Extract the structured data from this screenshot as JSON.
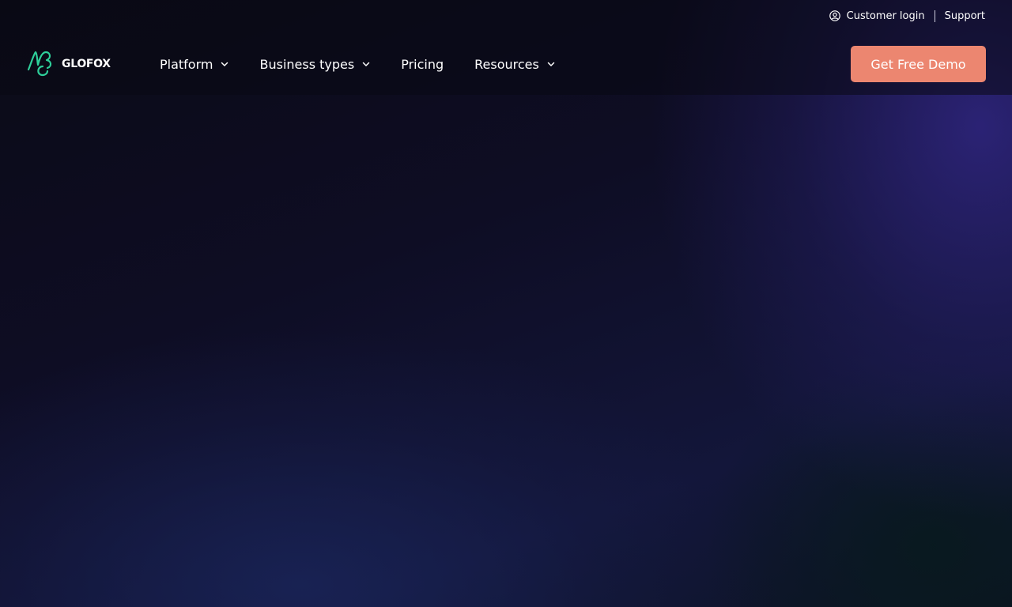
{
  "brand": {
    "name": "GLOFOX",
    "mark_color": "#2ecf9a"
  },
  "utility": {
    "customer_login": "Customer login",
    "support": "Support"
  },
  "nav": {
    "items": [
      {
        "label": "Platform",
        "has_dropdown": true
      },
      {
        "label": "Business types",
        "has_dropdown": true
      },
      {
        "label": "Pricing",
        "has_dropdown": false
      },
      {
        "label": "Resources",
        "has_dropdown": true
      }
    ]
  },
  "cta": {
    "label": "Get Free Demo",
    "color": "#ec8670"
  },
  "theme": {
    "background": "#0c0c1c",
    "text": "#ffffff"
  }
}
